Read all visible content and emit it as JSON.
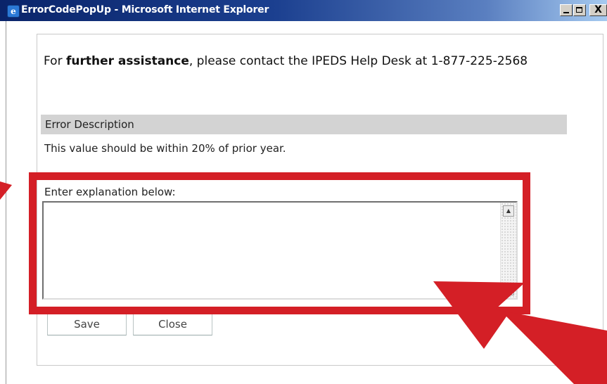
{
  "window": {
    "title": "ErrorCodePopUp - Microsoft Internet Explorer",
    "app_icon_glyph": "e",
    "close_glyph": "X"
  },
  "help": {
    "prefix": "For ",
    "bold_text": "further assistance",
    "suffix": ", please contact the IPEDS Help Desk at 1-877-225-2568"
  },
  "error": {
    "header": "Error Description",
    "description": "This value should be within 20% of prior year."
  },
  "explanation": {
    "label": "Enter explanation below:",
    "value": ""
  },
  "buttons": {
    "save": "Save",
    "close": "Close"
  },
  "annotation": {
    "highlight_color": "#d41f26"
  },
  "icons": [
    "ie-icon",
    "minimize-icon",
    "maximize-icon",
    "close-icon",
    "scroll-up-icon",
    "scroll-down-icon",
    "red-arrow-icon"
  ]
}
